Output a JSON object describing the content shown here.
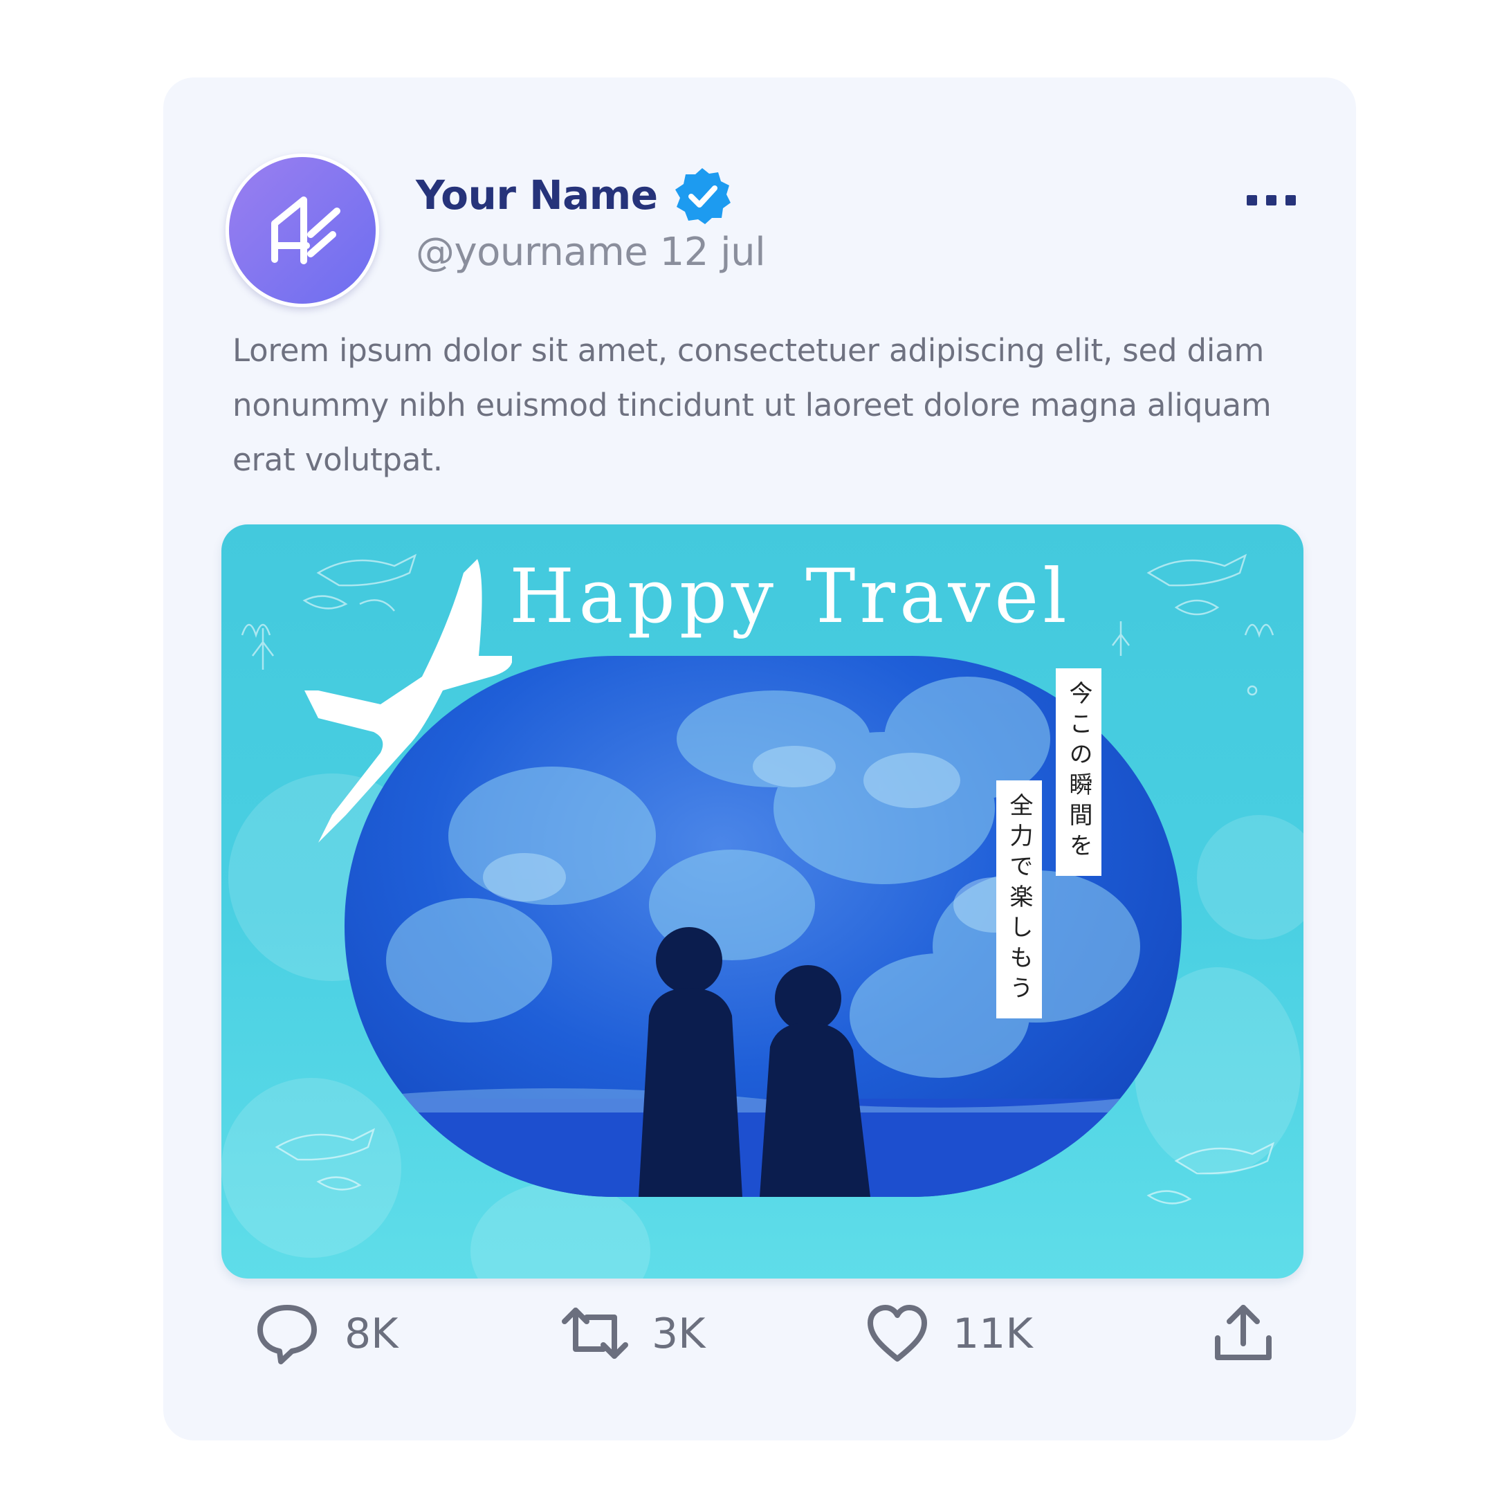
{
  "post": {
    "author": {
      "name": "Your Name",
      "handle": "@yourname",
      "date": "12 jul",
      "verified": true,
      "avatar_icon": "logo-icon"
    },
    "menu_icon": "more-horizontal-icon",
    "text": "Lorem ipsum dolor sit amet, consectetuer adipiscing elit, sed diam nonummy nibh euismod tincidunt ut laoreet dolore magna aliquam erat volutpat.",
    "media": {
      "title": "Happy Travel",
      "caption_1": "今この瞬間を",
      "caption_2": "全力で楽しもう",
      "decor_icon": "airplane-icon"
    },
    "actions": {
      "reply": {
        "icon": "comment-icon",
        "count": "8K"
      },
      "repost": {
        "icon": "repost-icon",
        "count": "3K"
      },
      "like": {
        "icon": "heart-icon",
        "count": "11K"
      },
      "share": {
        "icon": "share-icon"
      }
    }
  },
  "colors": {
    "card_bg": "#f3f6fd",
    "name": "#26337a",
    "verified": "#1d9bf0",
    "muted": "#8a8e9c",
    "media_bg": "#49cfe2"
  }
}
